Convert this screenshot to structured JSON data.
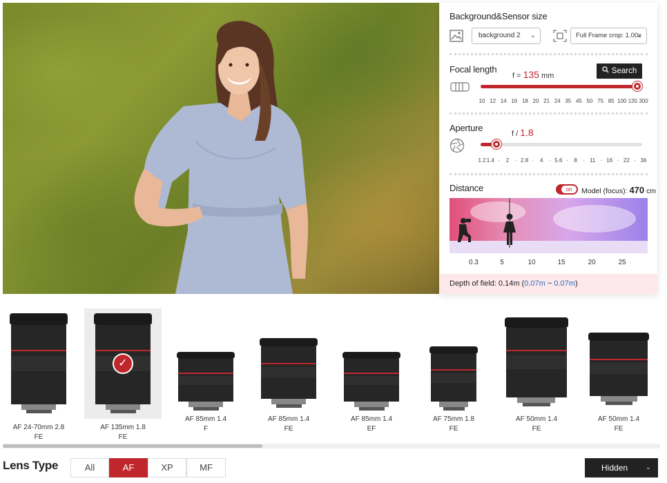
{
  "panel": {
    "background_title": "Background&Sensor size",
    "background_select": "background 2",
    "sensor_select": "Full Frame crop: 1.00x",
    "focal_title": "Focal length",
    "focal_prefix": "f = ",
    "focal_value": "135",
    "focal_unit": " mm",
    "search_label": "Search",
    "focal_ticks": [
      "10",
      "12",
      "14",
      "16",
      "18",
      "20",
      "21",
      "24",
      "35",
      "45",
      "50",
      "75",
      "85",
      "100",
      "135",
      "300"
    ],
    "focal_level": 0.97,
    "aperture_title": "Aperture",
    "aperture_prefix": "f / ",
    "aperture_value": "1.8",
    "aperture_ticks": [
      "1.2",
      "1.4",
      "·",
      "2",
      "·",
      "2.8",
      "·",
      "4",
      "·",
      "5.6",
      "·",
      "8",
      "·",
      "11",
      "·",
      "16",
      "·",
      "22",
      "·",
      "36"
    ],
    "aperture_level": 0.1,
    "distance_title": "Distance",
    "toggle_label": "on",
    "model_focus_label": "Model (focus): ",
    "model_focus_value": "470",
    "model_focus_unit": " cm",
    "distance_ticks": [
      "0.3",
      "5",
      "10",
      "15",
      "20",
      "25"
    ],
    "dof_label": "Depth of field: 0.14m (",
    "dof_near": "0.07m",
    "dof_sep": " ~ ",
    "dof_far": "0.07m",
    "dof_end": ")"
  },
  "lenses": [
    {
      "line1": "AF 24-70mm 2.8",
      "line2": "FE",
      "selected": false
    },
    {
      "line1": "AF 135mm 1.8",
      "line2": "FE",
      "selected": true
    },
    {
      "line1": "AF 85mm 1.4",
      "line2": "F",
      "selected": false
    },
    {
      "line1": "AF 85mm 1.4",
      "line2": "FE",
      "selected": false
    },
    {
      "line1": "AF 85mm 1.4",
      "line2": "EF",
      "selected": false
    },
    {
      "line1": "AF 75mm 1.8",
      "line2": "FE",
      "selected": false
    },
    {
      "line1": "AF 50mm 1.4",
      "line2": "FE",
      "selected": false
    },
    {
      "line1": "AF 50mm 1.4",
      "line2": "FE",
      "selected": false
    }
  ],
  "lens_type": {
    "title": "Lens Type",
    "filters": [
      "All",
      "AF",
      "XP",
      "MF"
    ],
    "active": "AF",
    "visibility_select": "Hidden"
  },
  "colors": {
    "accent": "#c0272d",
    "dark": "#222222",
    "link_blue": "#2e6bbd"
  }
}
